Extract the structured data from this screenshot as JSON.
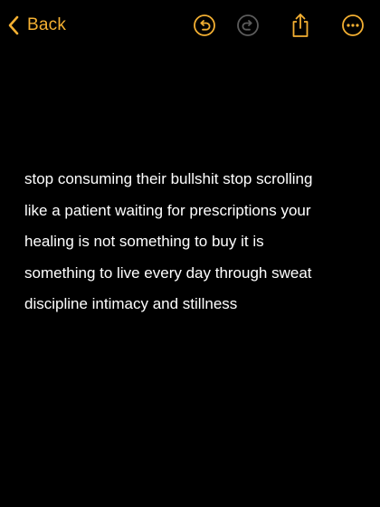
{
  "colors": {
    "accent": "#f4b032",
    "disabled": "#5c5c5c",
    "background": "#000000",
    "text": "#ffffff"
  },
  "nav": {
    "back_label": "Back",
    "back_icon": "chevron-left-icon",
    "undo_icon": "undo-icon",
    "redo_icon": "redo-icon",
    "share_icon": "share-icon",
    "more_icon": "more-icon"
  },
  "note": {
    "lines": [
      "stop consuming their bullshit stop scrolling",
      "like a patient waiting for prescriptions your",
      "healing is not something to buy it is",
      "something to live every day through sweat",
      "discipline intimacy and stillness"
    ]
  }
}
